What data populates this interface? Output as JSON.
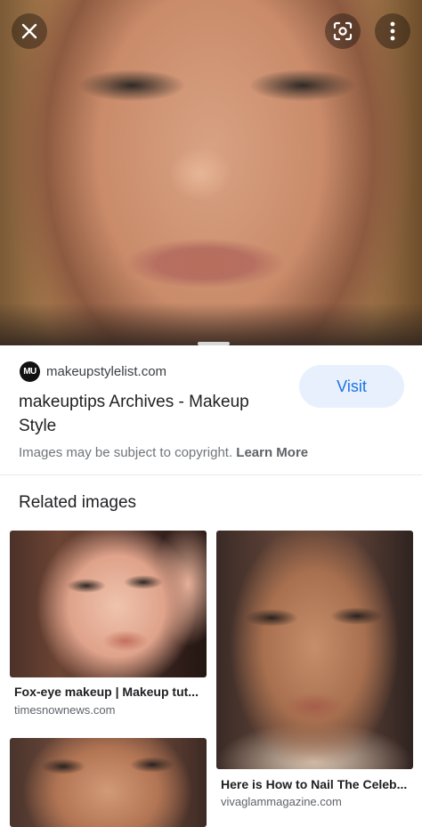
{
  "header": {
    "close_icon": "close-icon",
    "lens_icon": "lens-icon",
    "more_icon": "more-vertical-icon"
  },
  "result": {
    "site_avatar_text": "MU",
    "site_domain": "makeupstylelist.com",
    "title": "makeuptips Archives - Makeup Style",
    "visit_label": "Visit",
    "copyright_text": "Images may be subject to copyright.",
    "learn_more_label": "Learn More"
  },
  "related": {
    "heading": "Related images",
    "items": [
      {
        "title": "Fox-eye makeup | Makeup tut...",
        "source": "timesnownews.com"
      },
      {
        "title": "Here is How to Nail The Celeb...",
        "source": "vivaglammagazine.com"
      },
      {
        "title": "",
        "source": ""
      }
    ]
  },
  "colors": {
    "accent": "#1a73e8",
    "visit_bg": "#e8f0fe",
    "muted_text": "#70757a"
  }
}
